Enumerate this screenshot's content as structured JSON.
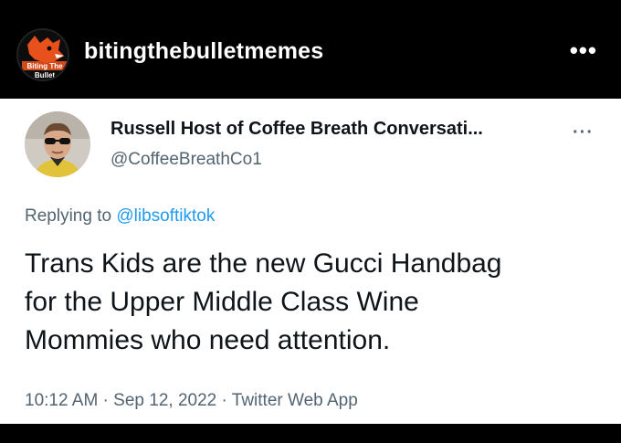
{
  "post_header": {
    "avatar_icon": "fox-logo-icon",
    "avatar_text": "Biting The Bullet",
    "username": "bitingthebulletmemes",
    "more_label": "•••"
  },
  "tweet": {
    "avatar_icon": "person-sunglasses-avatar-icon",
    "display_name": "Russell Host of Coffee Breath Conversati...",
    "handle": "@CoffeeBreathCo1",
    "more_label": "···",
    "replying_prefix": "Replying to ",
    "replying_to": "@libsoftiktok",
    "text_lines": [
      "Trans Kids are the new Gucci Handbag",
      "for the Upper Middle Class Wine",
      "Mommies who need attention."
    ],
    "time": "10:12 AM",
    "date": "Sep 12, 2022",
    "source": "Twitter Web App",
    "separator": " · "
  },
  "colors": {
    "background": "#000000",
    "card": "#ffffff",
    "text_primary": "#0f1419",
    "text_secondary": "#536471",
    "mention": "#1d9bf0",
    "logo_orange": "#e8501c"
  }
}
